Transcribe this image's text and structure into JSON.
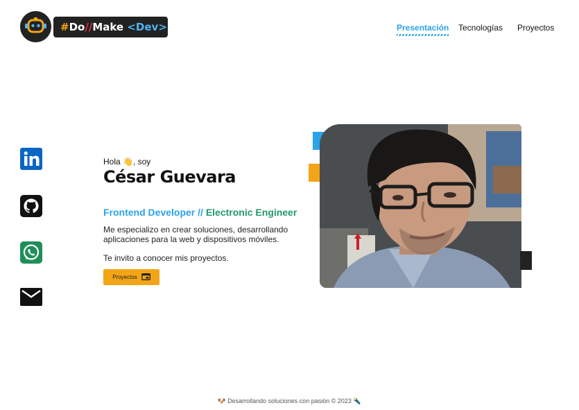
{
  "brand": {
    "hash": "#",
    "do": "Do",
    "slashes": "//",
    "make": "Make ",
    "dev": "<Dev>"
  },
  "nav": {
    "items": [
      {
        "label": "Presentación",
        "active": true
      },
      {
        "label": "Tecnologías",
        "active": false
      },
      {
        "label": "Proyectos",
        "active": false
      }
    ]
  },
  "social": [
    "linkedin-icon",
    "github-icon",
    "whatsapp-icon",
    "email-icon"
  ],
  "intro": {
    "greeting": "Hola 👋, soy",
    "name": "César Guevara",
    "role_primary": "Frontend Developer",
    "role_separator": " // ",
    "role_secondary": "Electronic Engineer",
    "description": "Me especializo en crear soluciones, desarrollando aplicaciones para la web y dispositivos móviles.",
    "invite": "Te invito a conocer mis proyectos.",
    "button_label": "Proyectos"
  },
  "footer": {
    "text": "🐶 Desarrollando soluciones con pasión © 2023 🔦"
  },
  "colors": {
    "accent_blue": "#2aa3e8",
    "accent_orange": "#f2a516",
    "accent_green": "#1f9a6a",
    "dark": "#222222"
  }
}
